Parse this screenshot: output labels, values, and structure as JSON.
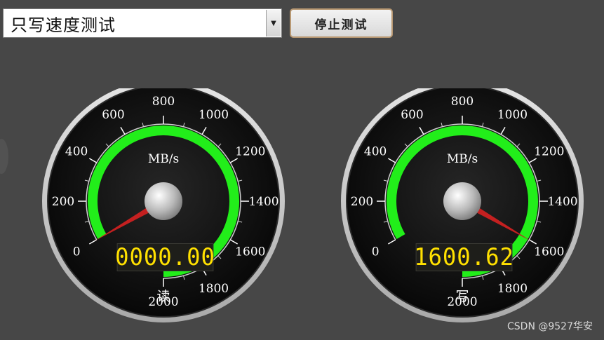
{
  "toolbar": {
    "mode_value": "只写速度测试",
    "dropdown_arrow": "▼",
    "stop_label": "停止测试"
  },
  "gauges": [
    {
      "unit": "MB/s",
      "caption": "读",
      "display": "0000.00",
      "value": 0,
      "min": 0,
      "max": 2000,
      "ticks": [
        "0",
        "200",
        "400",
        "600",
        "800",
        "1000",
        "1200",
        "1400",
        "1600",
        "1800",
        "2000"
      ],
      "green_band": [
        0,
        2000
      ]
    },
    {
      "unit": "MB/s",
      "caption": "写",
      "display": "1600.62",
      "value": 1600.62,
      "min": 0,
      "max": 2000,
      "ticks": [
        "0",
        "200",
        "400",
        "600",
        "800",
        "1000",
        "1200",
        "1400",
        "1600",
        "1800",
        "2000"
      ],
      "green_band": [
        0,
        2000
      ]
    }
  ],
  "colors": {
    "band": "#22ee1a",
    "needle": "#c42020",
    "lcd_text": "#ffe000",
    "bezel": "#cfcfcf"
  },
  "watermark": "CSDN @9527华安"
}
